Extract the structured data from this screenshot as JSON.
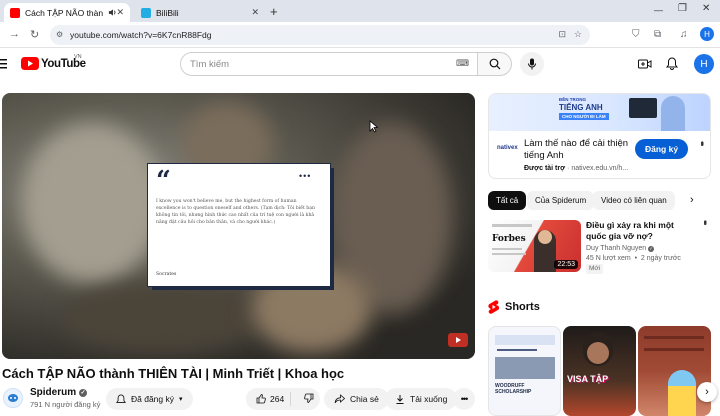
{
  "browser": {
    "tabs": [
      {
        "title": "Cách TẬP NÃO thành THIÊN",
        "active": true
      },
      {
        "title": "BiliBili",
        "active": false
      }
    ],
    "url": "youtube.com/watch?v=6K7cnR88Fdg"
  },
  "header": {
    "logo_text": "YouTube",
    "region": "VN",
    "search_placeholder": "Tìm kiếm",
    "avatar_letter": "H"
  },
  "player": {
    "quote_text": "I know you won't believe me, but the highest form of human excellence is to question oneself and others. (Tạm dịch: Tôi biết bạn không tin tôi, nhưng hình thức cao nhất của trí tuệ con người là khả năng đặt câu hỏi cho bản thân, và cho người khác.)",
    "quote_author": "Socrates"
  },
  "video": {
    "title": "Cách TẬP NÃO thành THIÊN TÀI | Minh Triết | Khoa học",
    "channel": "Spiderum",
    "subscribers": "791 N người đăng ký",
    "subscribed_label": "Đã đăng ký",
    "likes": "264",
    "share_label": "Chia sẻ",
    "download_label": "Tải xuống"
  },
  "ad": {
    "banner_kicker": "ĐỀN TRONG",
    "banner_title": "TIẾNG ANH",
    "banner_sub": "CHO NGƯỜI ĐI LÀM",
    "brand": "nativex",
    "title": "Làm thế nào để cải thiện tiếng Anh",
    "sponsor_label": "Được tài trợ",
    "sponsor_domain": "nativex.edu.vn/h...",
    "cta": "Đăng ký"
  },
  "chips": [
    "Tất cả",
    "Của Spiderum",
    "Video có liên quan"
  ],
  "suggested": {
    "thumb_brand": "Forbes",
    "duration": "22:53",
    "title": "Điều gì xảy ra khi một quốc gia vỡ nợ?",
    "channel": "Duy Thanh Nguyen",
    "meta": "45 N lượt xem  •  2 ngày trước",
    "badge": "Mới"
  },
  "shorts": {
    "heading": "Shorts",
    "items": [
      {
        "caption": "WOODRUFF SCHOLARSHIP"
      },
      {
        "caption": "VISA TẬP"
      },
      {
        "caption": ""
      }
    ]
  },
  "colors": {
    "brand_red": "#ff0000",
    "avatar_blue": "#1a73e8",
    "cta_blue": "#065fd4",
    "player_card_navy": "#1e2a44"
  }
}
